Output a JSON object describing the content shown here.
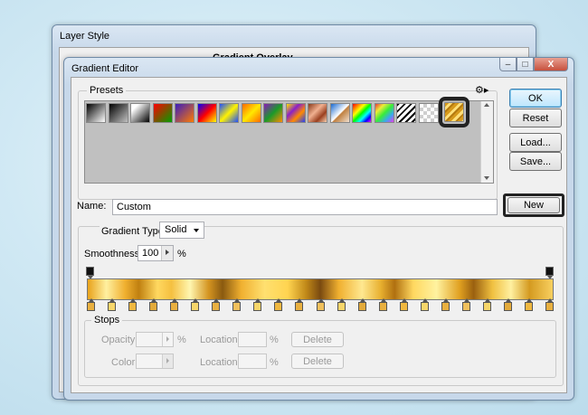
{
  "layer_style": {
    "title": "Layer Style",
    "section_label": "Gradient Overlay"
  },
  "gradient_editor": {
    "title": "Gradient Editor",
    "window_controls": {
      "minimize": "–",
      "maximize": "□",
      "close": "X"
    },
    "presets": {
      "label": "Presets",
      "menu_icon": "gear-icon",
      "swatches": [
        {
          "name": "black-white",
          "css": "linear-gradient(135deg,#000 0%,#fff 100%)"
        },
        {
          "name": "black-transparent",
          "css": "linear-gradient(135deg,#000 0%,rgba(0,0,0,0) 100%)"
        },
        {
          "name": "white-black",
          "css": "linear-gradient(135deg,#fff 20%,#000 100%)"
        },
        {
          "name": "red-green",
          "css": "linear-gradient(135deg,#ff0000 0%,#00a000 100%)"
        },
        {
          "name": "violet-orange",
          "css": "linear-gradient(135deg,#3a1dbf 0%,#ff7b00 100%)"
        },
        {
          "name": "blue-red-yellow",
          "css": "linear-gradient(135deg,#0000ff 0%,#ff0000 50%,#ffff00 100%)"
        },
        {
          "name": "blue-yellow-blue",
          "css": "linear-gradient(135deg,#1e4fff 0%,#fff200 50%,#1e4fff 100%)"
        },
        {
          "name": "orange-yellow-orange",
          "css": "linear-gradient(135deg,#ff6a00 0%,#ffe800 50%,#ff6a00 100%)"
        },
        {
          "name": "violet-green-orange",
          "css": "linear-gradient(135deg,#8a1ab8 0%,#1a9a2a 50%,#ff8c00 100%)"
        },
        {
          "name": "yellow-violet-orange-blue",
          "css": "linear-gradient(135deg,#ffe400 0%,#8a20c8 35%,#ff8a00 65%,#2040ff 100%)"
        },
        {
          "name": "copper",
          "css": "linear-gradient(135deg,#8a3a1a 0%,#f0b090 40%,#9a4020 70%,#f8d0b0 100%)"
        },
        {
          "name": "chrome",
          "css": "linear-gradient(135deg,#1a6ad0 0%,#ffffff 50%,#c08040 55%,#f0e0d0 100%)"
        },
        {
          "name": "spectrum",
          "css": "linear-gradient(135deg,#ff0000,#ff8000,#ffff00,#00ff00,#00ffff,#0000ff,#ff00ff)"
        },
        {
          "name": "transparent-rainbow",
          "css": "linear-gradient(135deg,rgba(255,0,0,0.7),rgba(255,255,0,0.7),rgba(0,255,0,0.7),rgba(0,160,255,0.7),rgba(255,0,255,0.7))"
        },
        {
          "name": "transparent-stripes",
          "css": "repeating-linear-gradient(135deg,#000 0 2px,#fff 2px 5px)"
        },
        {
          "name": "checker-transparent",
          "css": "repeating-conic-gradient(#cfcfcf 0 25%,#ffffff 0 50%) 0 0/8px 8px"
        },
        {
          "name": "custom-gold",
          "css": "repeating-linear-gradient(135deg,#d79a1c 0 3px,#ffe07a 3px 6px,#b57a10 6px 8px)"
        }
      ]
    },
    "buttons": {
      "ok": "OK",
      "reset": "Reset",
      "load": "Load...",
      "save": "Save...",
      "new": "New"
    },
    "name_field": {
      "label": "Name:",
      "value": "Custom"
    },
    "gradient_type": {
      "label": "Gradient Type:",
      "value": "Solid"
    },
    "smoothness": {
      "label": "Smoothness:",
      "value": "100",
      "unit": "%"
    },
    "gradient_css": "linear-gradient(90deg,#e8a21a 0%,#fff0a0 4%,#f0b030 8%,#c08010 11%,#ffd860 15%,#f5c040 18%,#fff6b0 22%,#d49420 26%,#8a5a10 29%,#f0b030 33%,#ffe070 38%,#ffd450 43%,#c08818 47%,#7a4a10 50%,#f0b030 54%,#ffe890 59%,#e8b030 63%,#b07010 66%,#ffd860 70%,#fff2a0 75%,#e0a020 80%,#9a6010 83%,#f0c040 87%,#fff0a0 91%,#d49a20 95%,#f8d060 100%)",
    "stop_colors": [
      "#e9b040",
      "#f7d66a",
      "#f0b840",
      "#e3aa3a",
      "#e9b040",
      "#f7d66a",
      "#e9b040",
      "#f0c05c",
      "#f7d66a",
      "#f0b840",
      "#e9b040",
      "#f0c05c",
      "#f7d66a",
      "#e3aa3a",
      "#e9b040",
      "#f0b840",
      "#f7d66a",
      "#e9b040",
      "#f0c05c",
      "#f7d66a",
      "#e3aa3a",
      "#f0b840",
      "#e9b040"
    ],
    "stops": {
      "label": "Stops",
      "opacity_label": "Opacity:",
      "opacity_unit": "%",
      "location_label": "Location:",
      "location_unit": "%",
      "color_label": "Color:",
      "delete_label": "Delete"
    }
  }
}
